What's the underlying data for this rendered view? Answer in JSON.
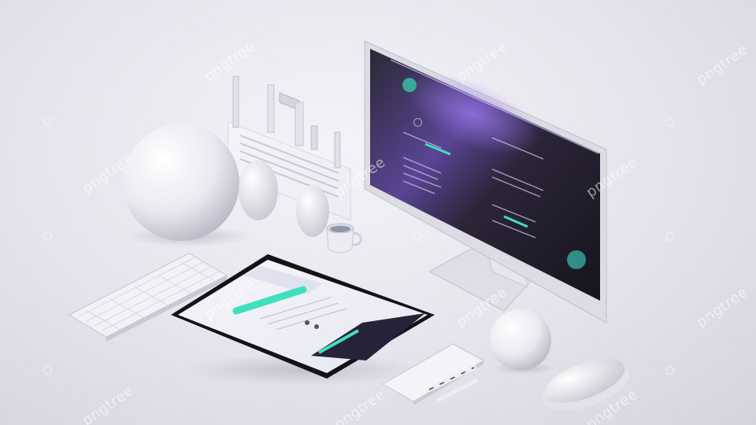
{
  "watermark": {
    "text": "pngtree"
  },
  "colors": {
    "background": "#e6e6ee",
    "screen_dark": "#1d1b24",
    "screen_purple": "#7a5ad0",
    "accent_teal": "#3fe0c0",
    "tablet_bezel": "#121218",
    "white_object": "#f4f4f8"
  },
  "objects": {
    "monitor": "desktop-monitor",
    "tablet": "tablet",
    "keyboard": "keyboard",
    "mouse": "mouse",
    "phone": "phone",
    "pen": "pen",
    "cup": "cup",
    "spheres": 2,
    "eggs": 2
  }
}
